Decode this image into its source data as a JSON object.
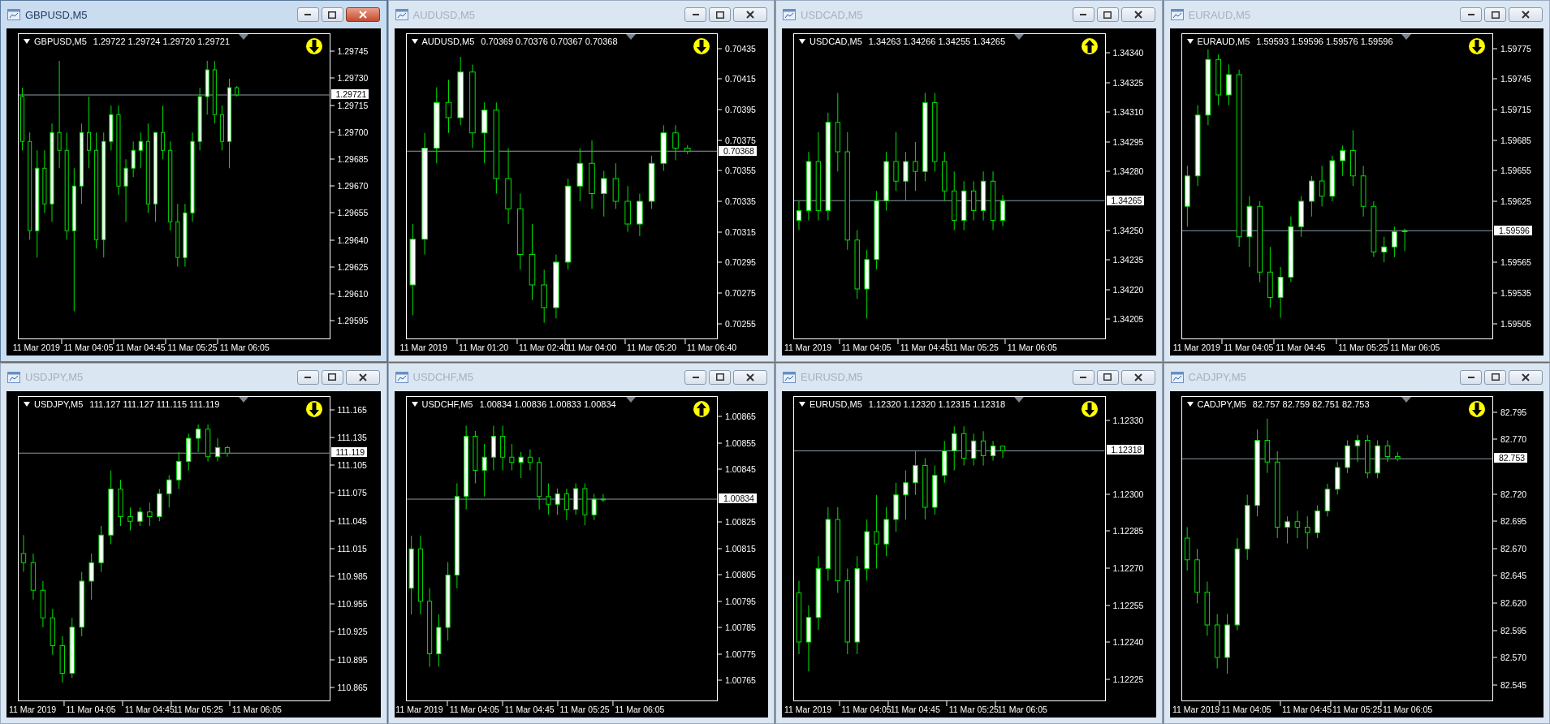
{
  "windows": [
    {
      "title": "GBPUSD,M5",
      "active": true,
      "symbol": "GBPUSD,M5",
      "quotes": "1.29722 1.29724 1.29720 1.29721",
      "arrow_up": false,
      "chart_data": {
        "type": "candlestick",
        "ylim": [
          1.29585,
          1.29755
        ],
        "yticks": [
          {
            "value": 1.29745,
            "label": "1.29745"
          },
          {
            "value": 1.2973,
            "label": "1.29730"
          },
          {
            "value": 1.29715,
            "label": "1.29715"
          },
          {
            "value": 1.297,
            "label": "1.29700"
          },
          {
            "value": 1.29685,
            "label": "1.29685"
          },
          {
            "value": 1.2967,
            "label": "1.29670"
          },
          {
            "value": 1.29655,
            "label": "1.29655"
          },
          {
            "value": 1.2964,
            "label": "1.29640"
          },
          {
            "value": 1.29625,
            "label": "1.29625"
          },
          {
            "value": 1.2961,
            "label": "1.29610"
          },
          {
            "value": 1.29595,
            "label": "1.29595"
          }
        ],
        "ref_lines": [
          {
            "axis": "y",
            "value": 1.29721,
            "label": "1.29721",
            "color": "#8c9aa8"
          }
        ],
        "categories": [
          null,
          null,
          "11 Mar 2019",
          null,
          null,
          null,
          null,
          null,
          null,
          "11 Mar 04:05",
          null,
          null,
          null,
          null,
          null,
          null,
          "11 Mar 04:45",
          null,
          null,
          null,
          null,
          null,
          null,
          "11 Mar 05:25",
          null,
          null,
          null,
          null,
          null,
          null,
          "11 Mar 06:05",
          null,
          null,
          null,
          null,
          null,
          null,
          null,
          null,
          null,
          null,
          null
        ],
        "ohlc": [
          [
            1.2972,
            1.29725,
            1.2969,
            1.29695
          ],
          [
            1.29695,
            1.297,
            1.2964,
            1.29645
          ],
          [
            1.29645,
            1.2969,
            1.2963,
            1.2968
          ],
          [
            1.2968,
            1.2969,
            1.29655,
            1.2966
          ],
          [
            1.2966,
            1.29705,
            1.2965,
            1.297
          ],
          [
            1.297,
            1.2974,
            1.2968,
            1.2969
          ],
          [
            1.2969,
            1.297,
            1.2964,
            1.29645
          ],
          [
            1.29645,
            1.2968,
            1.296,
            1.2967
          ],
          [
            1.2967,
            1.29705,
            1.2966,
            1.297
          ],
          [
            1.297,
            1.2972,
            1.2968,
            1.2969
          ],
          [
            1.2969,
            1.297,
            1.29635,
            1.2964
          ],
          [
            1.2964,
            1.297,
            1.2963,
            1.29695
          ],
          [
            1.29695,
            1.29715,
            1.2969,
            1.2971
          ],
          [
            1.2971,
            1.29715,
            1.29665,
            1.2967
          ],
          [
            1.2967,
            1.29685,
            1.2965,
            1.2968
          ],
          [
            1.2968,
            1.29695,
            1.29675,
            1.2969
          ],
          [
            1.2969,
            1.297,
            1.2968,
            1.29695
          ],
          [
            1.29695,
            1.29705,
            1.29655,
            1.2966
          ],
          [
            1.2966,
            1.297,
            1.2965,
            1.297
          ],
          [
            1.297,
            1.29715,
            1.29685,
            1.2969
          ],
          [
            1.2969,
            1.29695,
            1.29645,
            1.2965
          ],
          [
            1.2965,
            1.2966,
            1.29625,
            1.2963
          ],
          [
            1.2963,
            1.2966,
            1.29625,
            1.29655
          ],
          [
            1.29655,
            1.297,
            1.2965,
            1.29695
          ],
          [
            1.29695,
            1.29725,
            1.2969,
            1.2972
          ],
          [
            1.2972,
            1.2974,
            1.2971,
            1.29735
          ],
          [
            1.29735,
            1.2974,
            1.29705,
            1.2971
          ],
          [
            1.2971,
            1.29715,
            1.2969,
            1.29695
          ],
          [
            1.29695,
            1.2973,
            1.2968,
            1.29725
          ],
          [
            1.29725,
            1.29726,
            1.2972,
            1.29721
          ],
          null,
          null,
          null,
          null,
          null,
          null,
          null,
          null,
          null,
          null,
          null,
          null
        ]
      }
    },
    {
      "title": "AUDUSD,M5",
      "active": false,
      "symbol": "AUDUSD,M5",
      "quotes": "0.70369 0.70376 0.70367 0.70368",
      "arrow_up": false,
      "chart_data": {
        "type": "candlestick",
        "ylim": [
          0.70245,
          0.70445
        ],
        "yticks": [
          {
            "value": 0.70435,
            "label": "0.70435"
          },
          {
            "value": 0.70415,
            "label": "0.70415"
          },
          {
            "value": 0.70395,
            "label": "0.70395"
          },
          {
            "value": 0.70375,
            "label": "0.70375"
          },
          {
            "value": 0.70355,
            "label": "0.70355"
          },
          {
            "value": 0.70335,
            "label": "0.70335"
          },
          {
            "value": 0.70315,
            "label": "0.70315"
          },
          {
            "value": 0.70295,
            "label": "0.70295"
          },
          {
            "value": 0.70275,
            "label": "0.70275"
          },
          {
            "value": 0.70255,
            "label": "0.70255"
          }
        ],
        "ref_lines": [
          {
            "axis": "y",
            "value": 0.70368,
            "label": "0.70368",
            "color": "#8c9aa8"
          }
        ],
        "categories": [
          null,
          "11 Mar 2019",
          null,
          null,
          null,
          null,
          "11 Mar 01:20",
          null,
          null,
          null,
          null,
          "11 Mar 02:40",
          null,
          null,
          null,
          "11 Mar 04:00",
          null,
          null,
          null,
          null,
          "11 Mar 05:20",
          null,
          null,
          null,
          null,
          "11 Mar 06:40"
        ],
        "ohlc": [
          [
            0.7028,
            0.7032,
            0.7026,
            0.7031
          ],
          [
            0.7031,
            0.7038,
            0.703,
            0.7037
          ],
          [
            0.7037,
            0.7041,
            0.7036,
            0.704
          ],
          [
            0.704,
            0.70415,
            0.7038,
            0.7039
          ],
          [
            0.7039,
            0.7043,
            0.70385,
            0.7042
          ],
          [
            0.7042,
            0.70425,
            0.7037,
            0.7038
          ],
          [
            0.7038,
            0.704,
            0.7036,
            0.70395
          ],
          [
            0.70395,
            0.704,
            0.7034,
            0.7035
          ],
          [
            0.7035,
            0.7037,
            0.7032,
            0.7033
          ],
          [
            0.7033,
            0.7034,
            0.7029,
            0.703
          ],
          [
            0.703,
            0.7032,
            0.7027,
            0.7028
          ],
          [
            0.7028,
            0.7029,
            0.70255,
            0.70265
          ],
          [
            0.70265,
            0.703,
            0.70258,
            0.70295
          ],
          [
            0.70295,
            0.7035,
            0.7029,
            0.70345
          ],
          [
            0.70345,
            0.7037,
            0.70335,
            0.7036
          ],
          [
            0.7036,
            0.70375,
            0.7033,
            0.7034
          ],
          [
            0.7034,
            0.70355,
            0.70325,
            0.7035
          ],
          [
            0.7035,
            0.7036,
            0.7033,
            0.70335
          ],
          [
            0.70335,
            0.70345,
            0.70315,
            0.7032
          ],
          [
            0.7032,
            0.7034,
            0.70312,
            0.70335
          ],
          [
            0.70335,
            0.70365,
            0.7033,
            0.7036
          ],
          [
            0.7036,
            0.70385,
            0.70355,
            0.7038
          ],
          [
            0.7038,
            0.70385,
            0.70362,
            0.7037
          ],
          [
            0.7037,
            0.70372,
            0.70366,
            0.70368
          ],
          null,
          null
        ]
      }
    },
    {
      "title": "USDCAD,M5",
      "active": false,
      "symbol": "USDCAD,M5",
      "quotes": "1.34263 1.34266 1.34255 1.34265",
      "arrow_up": true,
      "chart_data": {
        "type": "candlestick",
        "ylim": [
          1.34195,
          1.3435
        ],
        "yticks": [
          {
            "value": 1.3434,
            "label": "1.34340"
          },
          {
            "value": 1.34325,
            "label": "1.34325"
          },
          {
            "value": 1.3431,
            "label": "1.34310"
          },
          {
            "value": 1.34295,
            "label": "1.34295"
          },
          {
            "value": 1.3428,
            "label": "1.34280"
          },
          {
            "value": 1.3425,
            "label": "1.34250"
          },
          {
            "value": 1.34235,
            "label": "1.34235"
          },
          {
            "value": 1.3422,
            "label": "1.34220"
          },
          {
            "value": 1.34205,
            "label": "1.34205"
          }
        ],
        "ref_lines": [
          {
            "axis": "y",
            "value": 1.34265,
            "label": "1.34265",
            "color": "#8c9aa8"
          }
        ],
        "categories": [
          null,
          "11 Mar 2019",
          null,
          null,
          null,
          null,
          null,
          "11 Mar 04:05",
          null,
          null,
          null,
          null,
          null,
          "11 Mar 04:45",
          null,
          null,
          null,
          null,
          "11 Mar 05:25",
          null,
          null,
          null,
          null,
          null,
          "11 Mar 06:05",
          null,
          null,
          null,
          null,
          null,
          null,
          null
        ],
        "ohlc": [
          [
            1.34255,
            1.34265,
            1.3425,
            1.3426
          ],
          [
            1.3426,
            1.3429,
            1.34255,
            1.34285
          ],
          [
            1.34285,
            1.343,
            1.34255,
            1.3426
          ],
          [
            1.3426,
            1.3431,
            1.34255,
            1.34305
          ],
          [
            1.34305,
            1.3432,
            1.3428,
            1.3429
          ],
          [
            1.3429,
            1.343,
            1.3424,
            1.34245
          ],
          [
            1.34245,
            1.3425,
            1.34215,
            1.3422
          ],
          [
            1.3422,
            1.3424,
            1.34205,
            1.34235
          ],
          [
            1.34235,
            1.3427,
            1.3423,
            1.34265
          ],
          [
            1.34265,
            1.3429,
            1.3426,
            1.34285
          ],
          [
            1.34285,
            1.343,
            1.3427,
            1.34275
          ],
          [
            1.34275,
            1.3429,
            1.34265,
            1.34285
          ],
          [
            1.34285,
            1.34295,
            1.3427,
            1.3428
          ],
          [
            1.3428,
            1.3432,
            1.34275,
            1.34315
          ],
          [
            1.34315,
            1.3432,
            1.3428,
            1.34285
          ],
          [
            1.34285,
            1.3429,
            1.34265,
            1.3427
          ],
          [
            1.3427,
            1.3428,
            1.3425,
            1.34255
          ],
          [
            1.34255,
            1.34275,
            1.3425,
            1.3427
          ],
          [
            1.3427,
            1.34275,
            1.34255,
            1.3426
          ],
          [
            1.3426,
            1.3428,
            1.34255,
            1.34275
          ],
          [
            1.34275,
            1.3428,
            1.3425,
            1.34255
          ],
          [
            1.34255,
            1.34268,
            1.34252,
            1.34265
          ],
          null,
          null,
          null,
          null,
          null,
          null,
          null,
          null,
          null,
          null
        ]
      }
    },
    {
      "title": "EURAUD,M5",
      "active": false,
      "symbol": "EURAUD,M5",
      "quotes": "1.59593 1.59596 1.59576 1.59596",
      "arrow_up": false,
      "chart_data": {
        "type": "candlestick",
        "ylim": [
          1.5949,
          1.5979
        ],
        "yticks": [
          {
            "value": 1.59775,
            "label": "1.59775"
          },
          {
            "value": 1.59745,
            "label": "1.59745"
          },
          {
            "value": 1.59715,
            "label": "1.59715"
          },
          {
            "value": 1.59685,
            "label": "1.59685"
          },
          {
            "value": 1.59655,
            "label": "1.59655"
          },
          {
            "value": 1.59625,
            "label": "1.59625"
          },
          {
            "value": 1.59565,
            "label": "1.59565"
          },
          {
            "value": 1.59535,
            "label": "1.59535"
          },
          {
            "value": 1.59505,
            "label": "1.59505"
          }
        ],
        "ref_lines": [
          {
            "axis": "y",
            "value": 1.59596,
            "label": "1.59596",
            "color": "#8c9aa8"
          }
        ],
        "categories": [
          null,
          "11 Mar 2019",
          null,
          null,
          null,
          null,
          "11 Mar 04:05",
          null,
          null,
          null,
          null,
          "11 Mar 04:45",
          null,
          null,
          null,
          null,
          null,
          "11 Mar 05:25",
          null,
          null,
          null,
          null,
          "11 Mar 06:05",
          null,
          null,
          null,
          null,
          null,
          null,
          null
        ],
        "ohlc": [
          [
            1.5962,
            1.5966,
            1.596,
            1.5965
          ],
          [
            1.5965,
            1.5972,
            1.5964,
            1.5971
          ],
          [
            1.5971,
            1.59775,
            1.597,
            1.59765
          ],
          [
            1.59765,
            1.5977,
            1.5972,
            1.5973
          ],
          [
            1.5973,
            1.5976,
            1.5972,
            1.5975
          ],
          [
            1.5975,
            1.59755,
            1.5958,
            1.5959
          ],
          [
            1.5959,
            1.5963,
            1.5956,
            1.5962
          ],
          [
            1.5962,
            1.59625,
            1.59545,
            1.59555
          ],
          [
            1.59555,
            1.5958,
            1.5952,
            1.5953
          ],
          [
            1.5953,
            1.5956,
            1.5951,
            1.5955
          ],
          [
            1.5955,
            1.5961,
            1.59545,
            1.596
          ],
          [
            1.596,
            1.5963,
            1.5959,
            1.59625
          ],
          [
            1.59625,
            1.5965,
            1.5961,
            1.59645
          ],
          [
            1.59645,
            1.5966,
            1.5962,
            1.5963
          ],
          [
            1.5963,
            1.5967,
            1.59625,
            1.59665
          ],
          [
            1.59665,
            1.5968,
            1.5965,
            1.59675
          ],
          [
            1.59675,
            1.59695,
            1.5964,
            1.5965
          ],
          [
            1.5965,
            1.5966,
            1.5961,
            1.5962
          ],
          [
            1.5962,
            1.59625,
            1.5957,
            1.59575
          ],
          [
            1.59575,
            1.5959,
            1.59565,
            1.5958
          ],
          [
            1.5958,
            1.596,
            1.5957,
            1.59595
          ],
          [
            1.59595,
            1.59598,
            1.59576,
            1.59596
          ],
          null,
          null,
          null,
          null,
          null,
          null,
          null,
          null
        ]
      }
    },
    {
      "title": "USDJPY,M5",
      "active": false,
      "symbol": "USDJPY,M5",
      "quotes": "111.127 111.127 111.115 111.119",
      "arrow_up": false,
      "chart_data": {
        "type": "candlestick",
        "ylim": [
          110.85,
          111.18
        ],
        "yticks": [
          {
            "value": 111.165,
            "label": "111.165"
          },
          {
            "value": 111.135,
            "label": "111.135"
          },
          {
            "value": 111.105,
            "label": "111.105"
          },
          {
            "value": 111.075,
            "label": "111.075"
          },
          {
            "value": 111.045,
            "label": "111.045"
          },
          {
            "value": 111.015,
            "label": "111.015"
          },
          {
            "value": 110.985,
            "label": "110.985"
          },
          {
            "value": 110.955,
            "label": "110.955"
          },
          {
            "value": 110.925,
            "label": "110.925"
          },
          {
            "value": 110.895,
            "label": "110.895"
          },
          {
            "value": 110.865,
            "label": "110.865"
          }
        ],
        "ref_lines": [
          {
            "axis": "y",
            "value": 111.119,
            "label": "111.119",
            "color": "#8c9aa8"
          }
        ],
        "categories": [
          null,
          "11 Mar 2019",
          null,
          null,
          null,
          null,
          null,
          "11 Mar 04:05",
          null,
          null,
          null,
          null,
          null,
          "11 Mar 04:45",
          null,
          null,
          null,
          null,
          "11 Mar 05:25",
          null,
          null,
          null,
          null,
          null,
          "11 Mar 06:05",
          null,
          null,
          null,
          null,
          null,
          null,
          null
        ],
        "ohlc": [
          [
            111.01,
            111.03,
            110.99,
            111.0
          ],
          [
            111.0,
            111.01,
            110.96,
            110.97
          ],
          [
            110.97,
            110.98,
            110.93,
            110.94
          ],
          [
            110.94,
            110.95,
            110.9,
            110.91
          ],
          [
            110.91,
            110.92,
            110.87,
            110.88
          ],
          [
            110.88,
            110.94,
            110.875,
            110.93
          ],
          [
            110.93,
            110.99,
            110.92,
            110.98
          ],
          [
            110.98,
            111.01,
            110.96,
            111.0
          ],
          [
            111.0,
            111.04,
            110.99,
            111.03
          ],
          [
            111.03,
            111.1,
            111.02,
            111.08
          ],
          [
            111.08,
            111.09,
            111.04,
            111.05
          ],
          [
            111.05,
            111.06,
            111.035,
            111.045
          ],
          [
            111.045,
            111.06,
            111.04,
            111.055
          ],
          [
            111.055,
            111.065,
            111.04,
            111.05
          ],
          [
            111.05,
            111.08,
            111.045,
            111.075
          ],
          [
            111.075,
            111.095,
            111.06,
            111.09
          ],
          [
            111.09,
            111.12,
            111.08,
            111.11
          ],
          [
            111.11,
            111.14,
            111.1,
            111.135
          ],
          [
            111.135,
            111.15,
            111.12,
            111.145
          ],
          [
            111.145,
            111.15,
            111.11,
            111.115
          ],
          [
            111.115,
            111.135,
            111.11,
            111.125
          ],
          [
            111.125,
            111.127,
            111.115,
            111.119
          ],
          null,
          null,
          null,
          null,
          null,
          null,
          null,
          null,
          null,
          null
        ]
      }
    },
    {
      "title": "USDCHF,M5",
      "active": false,
      "symbol": "USDCHF,M5",
      "quotes": "1.00834 1.00836 1.00833 1.00834",
      "arrow_up": true,
      "chart_data": {
        "type": "candlestick",
        "ylim": [
          1.00757,
          1.00873
        ],
        "yticks": [
          {
            "value": 1.00865,
            "label": "1.00865"
          },
          {
            "value": 1.00855,
            "label": "1.00855"
          },
          {
            "value": 1.00845,
            "label": "1.00845"
          },
          {
            "value": 1.00825,
            "label": "1.00825"
          },
          {
            "value": 1.00815,
            "label": "1.00815"
          },
          {
            "value": 1.00805,
            "label": "1.00805"
          },
          {
            "value": 1.00795,
            "label": "1.00795"
          },
          {
            "value": 1.00785,
            "label": "1.00785"
          },
          {
            "value": 1.00775,
            "label": "1.00775"
          },
          {
            "value": 1.00765,
            "label": "1.00765"
          }
        ],
        "ref_lines": [
          {
            "axis": "y",
            "value": 1.00834,
            "label": "1.00834",
            "color": "#8c9aa8"
          }
        ],
        "categories": [
          null,
          "11 Mar 2019",
          null,
          null,
          null,
          null,
          null,
          "11 Mar 04:05",
          null,
          null,
          null,
          null,
          null,
          "11 Mar 04:45",
          null,
          null,
          null,
          null,
          null,
          "11 Mar 05:25",
          null,
          null,
          null,
          null,
          null,
          "11 Mar 06:05",
          null,
          null,
          null,
          null,
          null,
          null,
          null,
          null
        ],
        "ohlc": [
          [
            1.008,
            1.0082,
            1.0079,
            1.00815
          ],
          [
            1.00815,
            1.0082,
            1.0079,
            1.00795
          ],
          [
            1.00795,
            1.008,
            1.0077,
            1.00775
          ],
          [
            1.00775,
            1.0079,
            1.0077,
            1.00785
          ],
          [
            1.00785,
            1.0081,
            1.0078,
            1.00805
          ],
          [
            1.00805,
            1.0084,
            1.008,
            1.00835
          ],
          [
            1.00835,
            1.00862,
            1.0083,
            1.00858
          ],
          [
            1.00858,
            1.0086,
            1.0084,
            1.00845
          ],
          [
            1.00845,
            1.00855,
            1.00835,
            1.0085
          ],
          [
            1.0085,
            1.00862,
            1.00845,
            1.00858
          ],
          [
            1.00858,
            1.00862,
            1.00845,
            1.0085
          ],
          [
            1.0085,
            1.00855,
            1.00845,
            1.00848
          ],
          [
            1.00848,
            1.00852,
            1.00842,
            1.0085
          ],
          [
            1.0085,
            1.00853,
            1.00845,
            1.00848
          ],
          [
            1.00848,
            1.0085,
            1.0083,
            1.00835
          ],
          [
            1.00835,
            1.0084,
            1.00828,
            1.00832
          ],
          [
            1.00832,
            1.00838,
            1.00828,
            1.00836
          ],
          [
            1.00836,
            1.00838,
            1.00826,
            1.0083
          ],
          [
            1.0083,
            1.0084,
            1.00828,
            1.00838
          ],
          [
            1.00838,
            1.0084,
            1.00824,
            1.00828
          ],
          [
            1.00828,
            1.00836,
            1.00826,
            1.00834
          ],
          [
            1.00834,
            1.00836,
            1.00833,
            1.00834
          ],
          null,
          null,
          null,
          null,
          null,
          null,
          null,
          null,
          null,
          null,
          null,
          null
        ]
      }
    },
    {
      "title": "EURUSD,M5",
      "active": false,
      "symbol": "EURUSD,M5",
      "quotes": "1.12320 1.12320 1.12315 1.12318",
      "arrow_up": false,
      "chart_data": {
        "type": "candlestick",
        "ylim": [
          1.12216,
          1.1234
        ],
        "yticks": [
          {
            "value": 1.1233,
            "label": "1.12330"
          },
          {
            "value": 1.123,
            "label": "1.12300"
          },
          {
            "value": 1.12285,
            "label": "1.12285"
          },
          {
            "value": 1.1227,
            "label": "1.12270"
          },
          {
            "value": 1.12255,
            "label": "1.12255"
          },
          {
            "value": 1.1224,
            "label": "1.12240"
          },
          {
            "value": 1.12225,
            "label": "1.12225"
          }
        ],
        "ref_lines": [
          {
            "axis": "y",
            "value": 1.12318,
            "label": "1.12318",
            "color": "#8c9aa8"
          }
        ],
        "categories": [
          null,
          "11 Mar 2019",
          null,
          null,
          null,
          null,
          null,
          "11 Mar 04:05",
          null,
          null,
          null,
          null,
          "11 Mar 04:45",
          null,
          null,
          null,
          null,
          null,
          "11 Mar 05:25",
          null,
          null,
          null,
          null,
          "11 Mar 06:05",
          null,
          null,
          null,
          null,
          null,
          null,
          null,
          null
        ],
        "ohlc": [
          [
            1.1226,
            1.12265,
            1.12235,
            1.1224
          ],
          [
            1.1224,
            1.12255,
            1.12228,
            1.1225
          ],
          [
            1.1225,
            1.12275,
            1.12245,
            1.1227
          ],
          [
            1.1227,
            1.12295,
            1.12265,
            1.1229
          ],
          [
            1.1229,
            1.12295,
            1.1226,
            1.12265
          ],
          [
            1.12265,
            1.1227,
            1.12235,
            1.1224
          ],
          [
            1.1224,
            1.12275,
            1.12235,
            1.1227
          ],
          [
            1.1227,
            1.1229,
            1.12265,
            1.12285
          ],
          [
            1.12285,
            1.123,
            1.1227,
            1.1228
          ],
          [
            1.1228,
            1.12295,
            1.12275,
            1.1229
          ],
          [
            1.1229,
            1.12305,
            1.12285,
            1.123
          ],
          [
            1.123,
            1.1231,
            1.1229,
            1.12305
          ],
          [
            1.12305,
            1.12318,
            1.123,
            1.12312
          ],
          [
            1.12312,
            1.12315,
            1.1229,
            1.12295
          ],
          [
            1.12295,
            1.12312,
            1.12292,
            1.12308
          ],
          [
            1.12308,
            1.12322,
            1.12305,
            1.12318
          ],
          [
            1.12318,
            1.12328,
            1.1231,
            1.12325
          ],
          [
            1.12325,
            1.12328,
            1.12312,
            1.12315
          ],
          [
            1.12315,
            1.12325,
            1.12312,
            1.12322
          ],
          [
            1.12322,
            1.12326,
            1.12312,
            1.12316
          ],
          [
            1.12316,
            1.12322,
            1.12314,
            1.1232
          ],
          [
            1.1232,
            1.1232,
            1.12315,
            1.12318
          ],
          null,
          null,
          null,
          null,
          null,
          null,
          null,
          null,
          null,
          null
        ]
      }
    },
    {
      "title": "CADJPY,M5",
      "active": false,
      "symbol": "CADJPY,M5",
      "quotes": "82.757 82.759 82.751 82.753",
      "arrow_up": false,
      "chart_data": {
        "type": "candlestick",
        "ylim": [
          82.53,
          82.81
        ],
        "yticks": [
          {
            "value": 82.795,
            "label": "82.795"
          },
          {
            "value": 82.77,
            "label": "82.770"
          },
          {
            "value": 82.72,
            "label": "82.720"
          },
          {
            "value": 82.695,
            "label": "82.695"
          },
          {
            "value": 82.67,
            "label": "82.670"
          },
          {
            "value": 82.645,
            "label": "82.645"
          },
          {
            "value": 82.62,
            "label": "82.620"
          },
          {
            "value": 82.595,
            "label": "82.595"
          },
          {
            "value": 82.57,
            "label": "82.570"
          },
          {
            "value": 82.545,
            "label": "82.545"
          }
        ],
        "ref_lines": [
          {
            "axis": "y",
            "value": 82.753,
            "label": "82.753",
            "color": "#8c9aa8"
          }
        ],
        "categories": [
          null,
          "11 Mar 2019",
          null,
          null,
          null,
          null,
          "11 Mar 04:05",
          null,
          null,
          null,
          null,
          null,
          "11 Mar 04:45",
          null,
          null,
          null,
          null,
          "11 Mar 05:25",
          null,
          null,
          null,
          null,
          "11 Mar 06:05",
          null,
          null,
          null,
          null,
          null,
          null,
          null,
          null
        ],
        "ohlc": [
          [
            82.68,
            82.69,
            82.65,
            82.66
          ],
          [
            82.66,
            82.67,
            82.62,
            82.63
          ],
          [
            82.63,
            82.64,
            82.59,
            82.6
          ],
          [
            82.6,
            82.61,
            82.56,
            82.57
          ],
          [
            82.57,
            82.61,
            82.555,
            82.6
          ],
          [
            82.6,
            82.68,
            82.595,
            82.67
          ],
          [
            82.67,
            82.72,
            82.66,
            82.71
          ],
          [
            82.71,
            82.78,
            82.7,
            82.77
          ],
          [
            82.77,
            82.79,
            82.74,
            82.75
          ],
          [
            82.75,
            82.76,
            82.68,
            82.69
          ],
          [
            82.69,
            82.7,
            82.675,
            82.695
          ],
          [
            82.695,
            82.705,
            82.68,
            82.69
          ],
          [
            82.69,
            82.7,
            82.67,
            82.685
          ],
          [
            82.685,
            82.71,
            82.68,
            82.705
          ],
          [
            82.705,
            82.73,
            82.7,
            82.725
          ],
          [
            82.725,
            82.75,
            82.72,
            82.745
          ],
          [
            82.745,
            82.77,
            82.74,
            82.765
          ],
          [
            82.765,
            82.775,
            82.75,
            82.77
          ],
          [
            82.77,
            82.775,
            82.735,
            82.74
          ],
          [
            82.74,
            82.77,
            82.735,
            82.765
          ],
          [
            82.765,
            82.77,
            82.75,
            82.755
          ],
          [
            82.755,
            82.759,
            82.751,
            82.753
          ],
          null,
          null,
          null,
          null,
          null,
          null,
          null,
          null,
          null
        ]
      }
    }
  ]
}
